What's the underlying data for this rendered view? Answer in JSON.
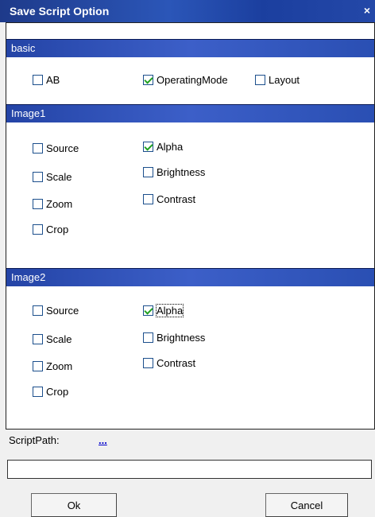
{
  "window": {
    "title": "Save Script Option",
    "close_glyph": "×"
  },
  "sections": {
    "basic": {
      "title": "basic",
      "ab": {
        "label": "AB",
        "checked": false
      },
      "operating_mode": {
        "label": "OperatingMode",
        "checked": true
      },
      "layout": {
        "label": "Layout",
        "checked": false
      }
    },
    "image1": {
      "title": "Image1",
      "source": {
        "label": "Source",
        "checked": false
      },
      "scale": {
        "label": "Scale",
        "checked": false
      },
      "zoom": {
        "label": "Zoom",
        "checked": false
      },
      "crop": {
        "label": "Crop",
        "checked": false
      },
      "alpha": {
        "label": "Alpha",
        "checked": true
      },
      "brightness": {
        "label": "Brightness",
        "checked": false
      },
      "contrast": {
        "label": "Contrast",
        "checked": false
      }
    },
    "image2": {
      "title": "Image2",
      "source": {
        "label": "Source",
        "checked": false
      },
      "scale": {
        "label": "Scale",
        "checked": false
      },
      "zoom": {
        "label": "Zoom",
        "checked": false
      },
      "crop": {
        "label": "Crop",
        "checked": false
      },
      "alpha": {
        "label": "Alpha",
        "checked": true
      },
      "brightness": {
        "label": "Brightness",
        "checked": false
      },
      "contrast": {
        "label": "Contrast",
        "checked": false
      }
    }
  },
  "script_path": {
    "label": "ScriptPath:",
    "browse": "...",
    "value": ""
  },
  "buttons": {
    "ok": "Ok",
    "cancel": "Cancel"
  }
}
